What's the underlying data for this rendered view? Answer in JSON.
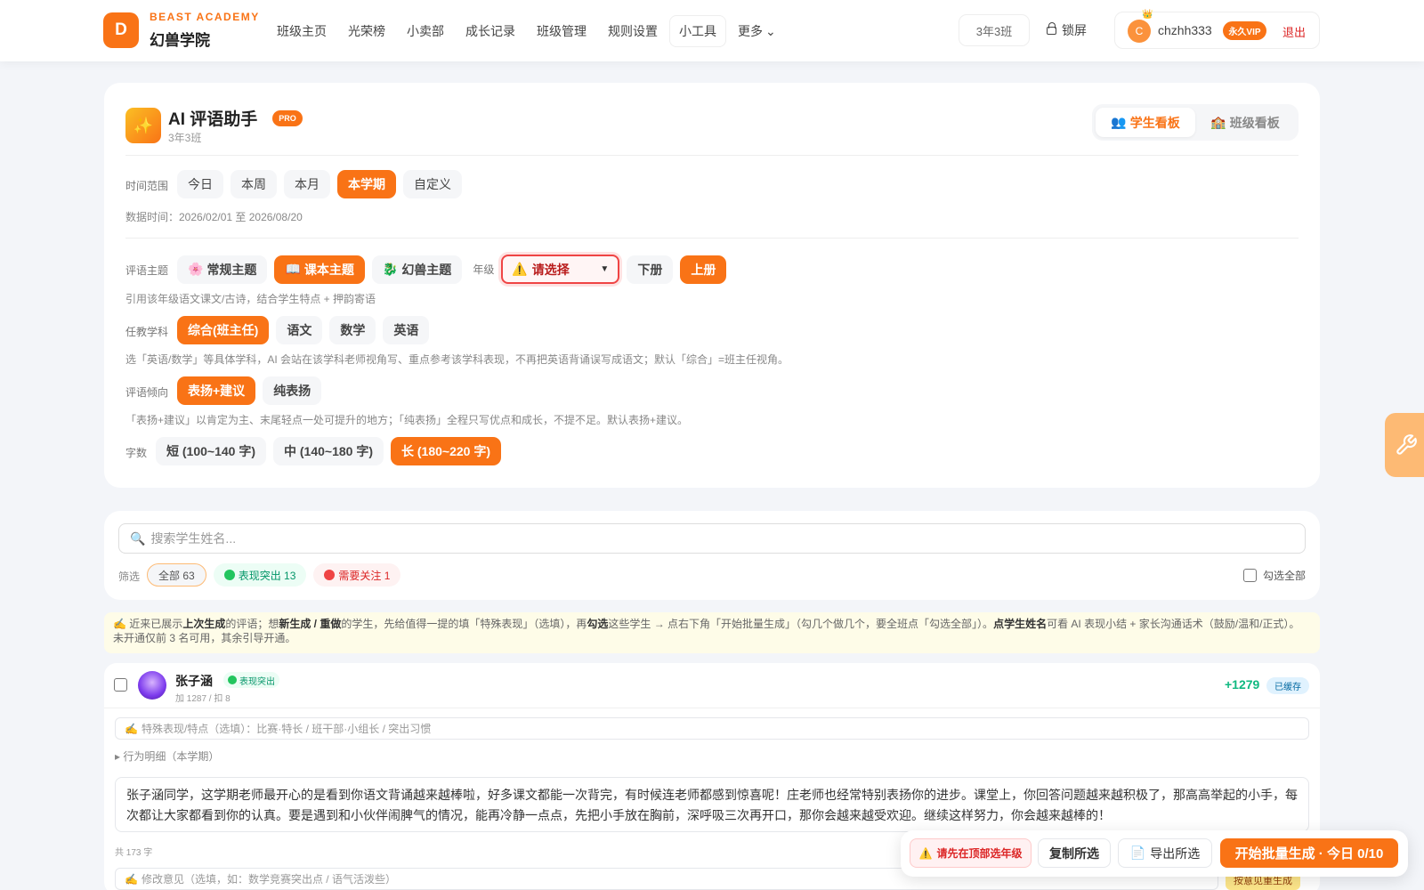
{
  "brand": {
    "logo_letter": "D",
    "name_en": "BEAST ACADEMY",
    "name_cn": "幻兽学院"
  },
  "nav": {
    "items": [
      {
        "label": "班级主页"
      },
      {
        "label": "光荣榜"
      },
      {
        "label": "小卖部"
      },
      {
        "label": "成长记录"
      },
      {
        "label": "班级管理"
      },
      {
        "label": "规则设置"
      },
      {
        "label": "小工具"
      },
      {
        "label": "更多"
      }
    ]
  },
  "header": {
    "class_name": "3年3班",
    "lock_label": "锁屏",
    "user": {
      "initial": "C",
      "name": "chzhh333",
      "vip_label": "永久VIP",
      "logout_label": "退出"
    }
  },
  "panel": {
    "title": "AI 评语助手",
    "pro_badge": "PRO",
    "subtitle": "3年3班",
    "tabs": [
      {
        "label": "学生看板",
        "icon": "👥"
      },
      {
        "label": "班级看板",
        "icon": "🏫"
      }
    ],
    "time": {
      "label": "时间范围",
      "options": [
        "今日",
        "本周",
        "本月",
        "本学期",
        "自定义"
      ],
      "selected": "本学期",
      "range_text": "数据时间：2026/02/01 至 2026/08/20"
    },
    "theme": {
      "label": "评语主题",
      "options": [
        {
          "icon": "🌸",
          "label": "常规主题"
        },
        {
          "icon": "📖",
          "label": "课本主题"
        },
        {
          "icon": "🐉",
          "label": "幻兽主题"
        }
      ],
      "selected": "课本主题",
      "hint": "引用该年级语文课文/古诗，结合学生特点 + 押韵寄语"
    },
    "grade": {
      "label": "年级",
      "select_value": "请选择",
      "warning_icon": "⚠️",
      "volumes": [
        "下册",
        "上册"
      ],
      "selected_volume": "上册"
    },
    "subject": {
      "label": "任教学科",
      "options": [
        "综合(班主任)",
        "语文",
        "数学",
        "英语"
      ],
      "selected": "综合(班主任)",
      "hint": "选「英语/数学」等具体学科，AI 会站在该学科老师视角写、重点参考该学科表现，不再把英语背诵误写成语文；默认「综合」=班主任视角。"
    },
    "tendency": {
      "label": "评语倾向",
      "options": [
        "表扬+建议",
        "纯表扬"
      ],
      "selected": "表扬+建议",
      "hint": "「表扬+建议」以肯定为主、末尾轻点一处可提升的地方；「纯表扬」全程只写优点和成长，不提不足。默认表扬+建议。"
    },
    "length": {
      "label": "字数",
      "options": [
        "短 (100~140 字)",
        "中 (140~180 字)",
        "长 (180~220 字)"
      ],
      "selected": "长 (180~220 字)"
    }
  },
  "list": {
    "search_placeholder": "搜索学生姓名...",
    "filter_label": "筛选",
    "filters": [
      {
        "label": "全部 63"
      },
      {
        "label": "表现突出 13"
      },
      {
        "label": "需要关注 1"
      }
    ],
    "select_all_label": "勾选全部"
  },
  "notice": {
    "icon": "✍️",
    "p1": "近来已展示",
    "b1": "上次生成",
    "p2": "的评语；想",
    "b2": "新生成 / 重做",
    "p3": "的学生，先给值得一提的填「特殊表现」（选填），再",
    "b3": "勾选",
    "p4": "这些学生 → 点右下角「开始批量生成」（勾几个做几个，要全班点「勾选全部」）。",
    "b4": "点学生姓名",
    "p5": "可看 AI 表现小结 + 家长沟通话术（鼓励/温和/正式）。 未开通仅前 3 名可用，其余引导开通。"
  },
  "student": {
    "name": "张子涵",
    "badge": "表现突出",
    "meta": "加 1287 / 扣 8",
    "score": "+1279",
    "cached": "已缓存",
    "feature_placeholder": "特殊表现/特点（选填）：比赛·特长 / 班干部·小组长 / 突出习惯",
    "detail_toggle": "▸ 行为明细（本学期）",
    "comment": "张子涵同学，这学期老师最开心的是看到你语文背诵越来越棒啦，好多课文都能一次背完，有时候连老师都感到惊喜呢！庄老师也经常特别表扬你的进步。课堂上，你回答问题越来越积极了，那高高举起的小手，每次都让大家都看到你的认真。要是遇到和小伙伴闹脾气的情况，能再冷静一点点，先把小手放在胸前，深呼吸三次再开口，那你会越来越受欢迎。继续这样努力，你会越来越棒的！",
    "char_count": "共 173 字",
    "revise_placeholder": "修改意见（选填，如：数学竞赛突出点 / 语气活泼些）",
    "regen_label": "按意见重生成"
  },
  "actions": {
    "warning": "请先在顶部选年级",
    "copy": "复制所选",
    "export": "导出所选",
    "generate": "开始批量生成 · 今日 0/10"
  },
  "colors": {
    "accent": "#f97316",
    "danger": "#dc2626",
    "success": "#10b981"
  }
}
